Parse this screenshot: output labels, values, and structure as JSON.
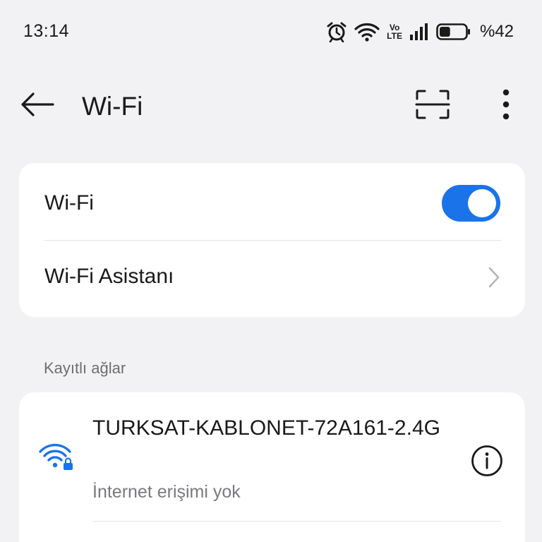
{
  "status_bar": {
    "time": "13:14",
    "volte_top": "Vo",
    "volte_bottom": "LTE",
    "battery_percent": "%42",
    "battery_level": 0.42,
    "icons": [
      "alarm-icon",
      "wifi-icon",
      "volte-icon",
      "signal-icon",
      "battery-icon"
    ]
  },
  "app_bar": {
    "title": "Wi-Fi",
    "icons": [
      "back-arrow-icon",
      "scan-qr-icon",
      "more-vert-icon"
    ]
  },
  "settings": {
    "wifi_label": "Wi-Fi",
    "wifi_enabled": true,
    "assistant_label": "Wi-Fi Asistanı"
  },
  "saved_networks": {
    "header": "Kayıtlı ağlar",
    "items": [
      {
        "name": "TURKSAT-KABLONET-72A161-2.4G",
        "status": "İnternet erişimi yok",
        "secured": true,
        "icon": "wifi-lock-icon"
      }
    ]
  },
  "colors": {
    "accent": "#1a73e8",
    "background": "#f2f2f4",
    "card": "#ffffff",
    "secondary_text": "#7a7a7e"
  }
}
